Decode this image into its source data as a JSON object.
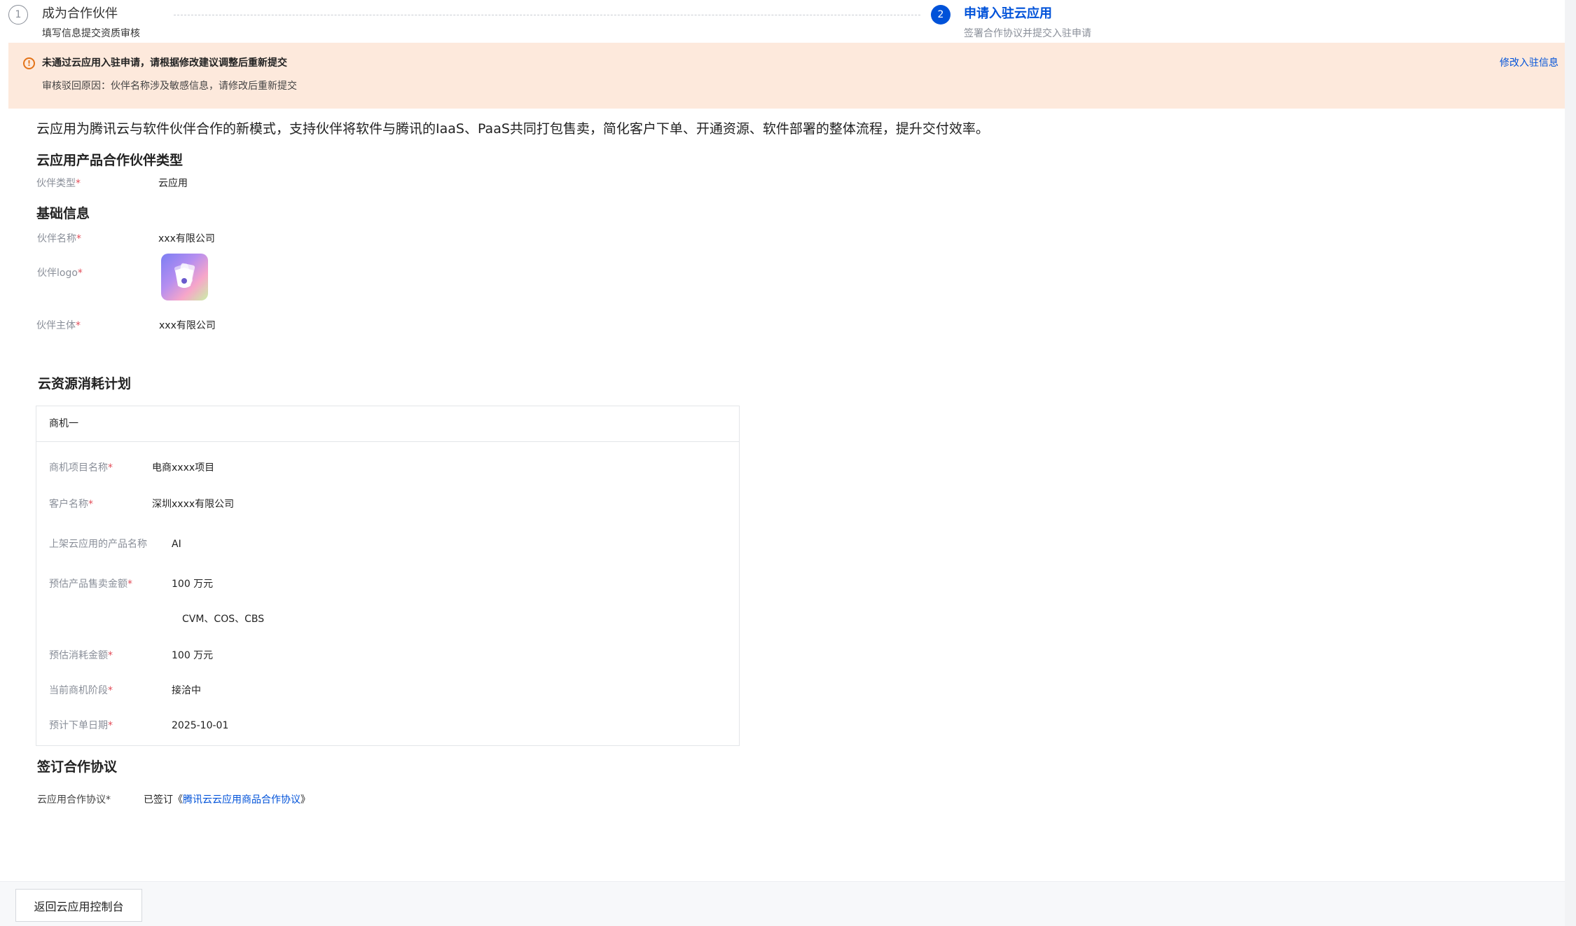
{
  "steps": [
    {
      "number": "1",
      "title": "成为合作伙伴",
      "desc": "填写信息提交资质审核"
    },
    {
      "number": "2",
      "title": "申请入驻云应用",
      "desc": "签署合作协议并提交入驻申请"
    }
  ],
  "alert": {
    "icon": "warning-circle-icon",
    "title": "未通过云应用入驻申请，请根据修改建议调整后重新提交",
    "desc": "审核驳回原因：伙伴名称涉及敏感信息，请修改后重新提交",
    "action_label": "修改入驻信息"
  },
  "intro": "云应用为腾讯云与软件伙伴合作的新模式，支持伙伴将软件与腾讯的IaaS、PaaS共同打包售卖，简化客户下单、开通资源、软件部署的整体流程，提升交付效率。",
  "partner_type": {
    "section_title": "云应用产品合作伙伴类型",
    "label": "伙伴类型",
    "value": "云应用"
  },
  "basic_info": {
    "section_title": "基础信息",
    "name_label": "伙伴名称",
    "name_value": "xxx有限公司",
    "logo_label": "伙伴logo",
    "entity_label": "伙伴主体",
    "entity_value": "xxx有限公司"
  },
  "resource_plan": {
    "section_title": "云资源消耗计划",
    "card_title": "商机一",
    "project_label": "商机项目名称",
    "project_value": "电商xxxx项目",
    "customer_label": "客户名称",
    "customer_value": "深圳xxxx有限公司",
    "product_label": "上架云应用的产品名称",
    "product_value": "AI",
    "sales_label": "预估产品售卖金额",
    "sales_value": "100 万元",
    "resources_value": "CVM、COS、CBS",
    "consume_label": "预估消耗金额",
    "consume_value": "100 万元",
    "stage_label": "当前商机阶段",
    "stage_value": "接洽中",
    "date_label": "预计下单日期",
    "date_value": "2025-10-01"
  },
  "agreement": {
    "section_title": "签订合作协议",
    "label": "云应用合作协议",
    "signed_prefix": "已签订《",
    "link_text": "腾讯云云应用商品合作协议",
    "signed_suffix": "》"
  },
  "required_mark": "*",
  "footer": {
    "back_label": "返回云应用控制台"
  },
  "colors": {
    "primary": "#0052d9",
    "warning": "#e37318",
    "alert_bg": "#fde9dc",
    "required": "#e34d59"
  }
}
